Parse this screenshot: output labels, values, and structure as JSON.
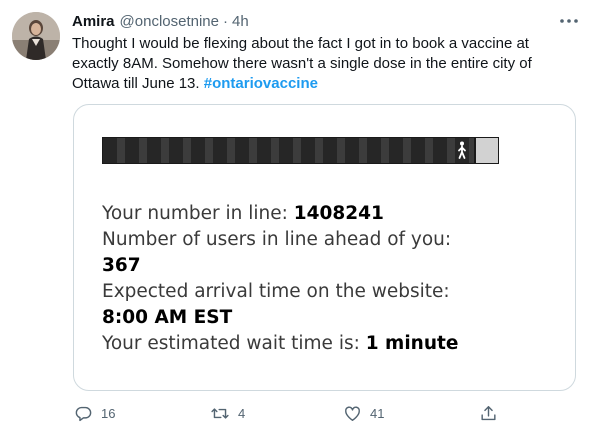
{
  "tweet": {
    "author_name": "Amira",
    "handle": "@onclosetnine",
    "separator": "·",
    "time": "4h",
    "text": "Thought I would be flexing about the fact I got in to book a vaccine at exactly 8AM. Somehow there wasn't a single dose in the entire city of Ottawa till June 13.",
    "hashtag": "#ontariovaccine"
  },
  "card": {
    "queue_progress": 0.94,
    "number_label": "Your number in line:",
    "number_value": "1408241",
    "ahead_label": "Number of users in line ahead of you:",
    "ahead_value": "367",
    "arrival_label": "Expected arrival time on the website:",
    "arrival_value": "8:00 AM EST",
    "wait_label": "Your estimated wait time is:",
    "wait_value": "1 minute"
  },
  "actions": {
    "reply_count": "16",
    "retweet_count": "4",
    "like_count": "41"
  },
  "icons": [
    "more-icon",
    "reply-icon",
    "retweet-icon",
    "like-icon",
    "share-icon",
    "walker-icon"
  ],
  "colors": {
    "accent": "#1d9bf0",
    "muted": "#536471",
    "text": "#0f1419",
    "border": "#cfd9de"
  }
}
